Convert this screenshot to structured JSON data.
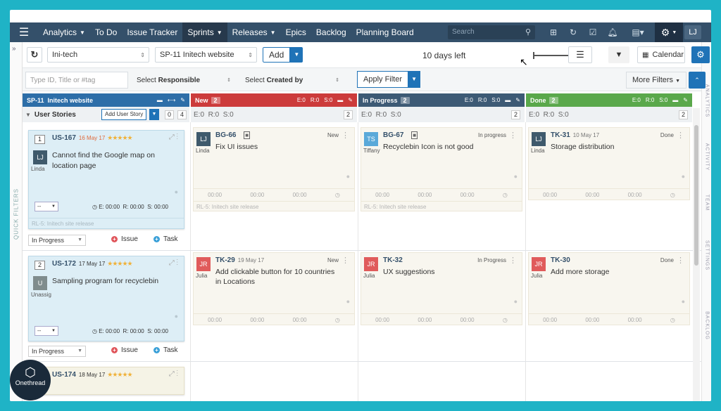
{
  "nav": {
    "items": [
      {
        "label": "Analytics",
        "caret": true
      },
      {
        "label": "To Do",
        "caret": false
      },
      {
        "label": "Issue Tracker",
        "caret": false
      },
      {
        "label": "Sprints",
        "caret": true,
        "active": true
      },
      {
        "label": "Releases",
        "caret": true
      },
      {
        "label": "Epics",
        "caret": false
      },
      {
        "label": "Backlog",
        "caret": false
      },
      {
        "label": "Planning Board",
        "caret": false
      }
    ],
    "search_placeholder": "Search",
    "user_initials": "LJ"
  },
  "toolbar": {
    "project": "Ini-tech",
    "sprint": "SP-11 Initech website",
    "add_label": "Add",
    "days_left": "10 days left",
    "calendar_label": "Calendar"
  },
  "filters": {
    "search_placeholder": "Type ID, Title or #tag",
    "responsible_prefix": "Select",
    "responsible_bold": "Responsible",
    "created_prefix": "Select",
    "created_bold": "Created by",
    "apply_label": "Apply Filter",
    "more_filters": "More Filters"
  },
  "left_panel": {
    "label": "QUICK FILTERS"
  },
  "right_panel": {
    "labels": [
      "ANALYTICS",
      "ACTIVITY",
      "TEAM",
      "SETTINGS",
      "BACKLOG"
    ]
  },
  "columns": [
    {
      "title": "SP-11",
      "subtitle": "Initech website",
      "color": "#2d6ea8"
    },
    {
      "title": "New",
      "count": "2",
      "e": "E:0",
      "r": "R:0",
      "s": "S:0",
      "color": "#cc3b3b"
    },
    {
      "title": "In Progress",
      "count": "2",
      "e": "E:0",
      "r": "R:0",
      "s": "S:0",
      "color": "#3d5a75"
    },
    {
      "title": "Done",
      "count": "2",
      "e": "E:0",
      "r": "R:0",
      "s": "S:0",
      "color": "#5aa84b"
    }
  ],
  "subheader": {
    "user_stories": "User Stories",
    "add_story": "Add User Story",
    "count_a": "0",
    "count_b": "4",
    "new": {
      "e": "E:0",
      "r": "R:0",
      "s": "S:0",
      "n": "2"
    },
    "inprogress": {
      "e": "E:0",
      "r": "R:0",
      "s": "S:0",
      "n": "2"
    },
    "done": {
      "e": "E:0",
      "r": "R:0",
      "s": "S:0",
      "n": "2"
    }
  },
  "stories": [
    {
      "num": "1",
      "id": "US-167",
      "date": "16 May 17",
      "stars": "★★★★★",
      "initials": "LJ",
      "name": "Linda",
      "title": "Cannot find the Google map on location page",
      "sel": "--",
      "e": "E: 00:00",
      "r": "R: 00:00",
      "s": "S: 00:00",
      "release": "RL-5: Initech site release",
      "status": "In Progress",
      "issue": "Issue",
      "task": "Task",
      "avcolor": "#3f5a6c"
    },
    {
      "num": "2",
      "id": "US-172",
      "date": "17 May 17",
      "stars": "★★★★★",
      "initials": "U",
      "name": "Unassig",
      "title": "Sampling program for recyclebin",
      "sel": "--",
      "e": "E: 00:00",
      "r": "R: 00:00",
      "s": "S: 00:00",
      "status": "In Progress",
      "issue": "Issue",
      "task": "Task",
      "avcolor": "#7f8c8d"
    },
    {
      "id": "US-174",
      "date": "18 May 17",
      "stars": "★★★★★"
    }
  ],
  "cards": [
    {
      "id": "BG-66",
      "status": "New",
      "initials": "LJ",
      "name": "Linda",
      "title": "Fix UI issues",
      "t1": "00:00",
      "t2": "00:00",
      "t3": "00:00",
      "release": "RL-5: Initech site release",
      "avcolor": "#3f5a6c"
    },
    {
      "id": "BG-67",
      "status": "In progress",
      "initials": "TS",
      "name": "Tiffany",
      "title": "Recyclebin Icon is not good",
      "t1": "00:00",
      "t2": "00:00",
      "t3": "00:00",
      "release": "RL-5: Initech site release",
      "avcolor": "#5aa9d9"
    },
    {
      "id": "TK-31",
      "date": "10 May 17",
      "status": "Done",
      "initials": "LJ",
      "name": "Linda",
      "title": "Storage distribution",
      "t1": "00:00",
      "t2": "00:00",
      "t3": "00:00",
      "avcolor": "#3f5a6c"
    },
    {
      "id": "TK-29",
      "date": "19 May 17",
      "status": "New",
      "initials": "JR",
      "name": "Julia",
      "title": "Add clickable button for 10 countries in Locations",
      "t1": "00:00",
      "t2": "00:00",
      "t3": "00:00",
      "avcolor": "#e05b5b"
    },
    {
      "id": "TK-32",
      "status": "In Progress",
      "initials": "JR",
      "name": "Julia",
      "title": "UX suggestions",
      "t1": "00:00",
      "t2": "00:00",
      "t3": "00:00",
      "avcolor": "#e05b5b"
    },
    {
      "id": "TK-30",
      "status": "Done",
      "initials": "JR",
      "name": "Julia",
      "title": "Add more storage",
      "t1": "00:00",
      "t2": "00:00",
      "t3": "00:00",
      "avcolor": "#e05b5b"
    }
  ],
  "watermark": {
    "brand": "Onethread"
  }
}
